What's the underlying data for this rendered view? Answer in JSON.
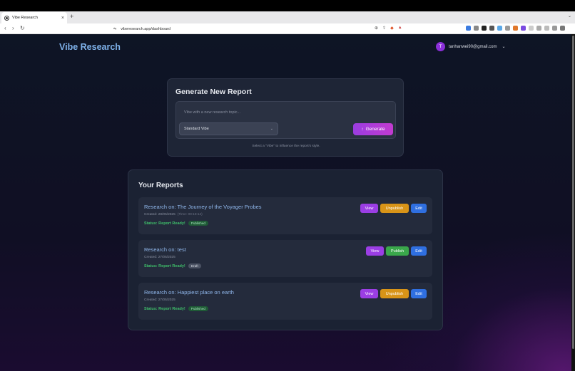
{
  "browser": {
    "tab_title": "Vibe Research",
    "url": "viberesearch.app/dashboard",
    "new_tab_glyph": "+",
    "close_glyph": "×"
  },
  "header": {
    "brand": "Vibe Research",
    "avatar_initial": "T",
    "user_email": "tanhanwei90@gmail.com"
  },
  "generator": {
    "title": "Generate New Report",
    "topic_placeholder": "Vibe with a new research topic...",
    "vibe_selected": "Standard Vibe",
    "generate_label": "Generate",
    "hint": "Select a \"Vibe\" to influence the report's style."
  },
  "reports": {
    "title": "Your Reports",
    "items": [
      {
        "title": "Research on: The Journey of the Voyager Probes",
        "created": "Created: 28/05/2025",
        "time": "(Time: 00:18:14)",
        "status": "Status: Report Ready!",
        "badge": "Published",
        "view_label": "View",
        "toggle_label": "Unpublish",
        "edit_label": "Edit"
      },
      {
        "title": "Research on: test",
        "created": "Created: 27/05/2025",
        "time": "",
        "status": "Status: Report Ready!",
        "badge": "Draft",
        "view_label": "View",
        "toggle_label": "Publish",
        "edit_label": "Edit"
      },
      {
        "title": "Research on: Happiest place on earth",
        "created": "Created: 27/05/2025",
        "time": "",
        "status": "Status: Report Ready!",
        "badge": "Published",
        "view_label": "View",
        "toggle_label": "Unpublish",
        "edit_label": "Edit"
      }
    ]
  },
  "colors": {
    "brand": "#7fb2ea",
    "view": "#9b3ee4",
    "unpublish": "#d89418",
    "publish": "#3aa84b",
    "edit": "#2f6fe0",
    "status_ready": "#3fbf6a"
  },
  "icons": {
    "favicon": "globe-icon",
    "back": "back-arrow-icon",
    "forward": "forward-arrow-icon",
    "reload": "reload-icon",
    "user_menu": "chevron-down-icon",
    "select": "chevron-down-icon",
    "generate": "arrow-up-icon"
  }
}
